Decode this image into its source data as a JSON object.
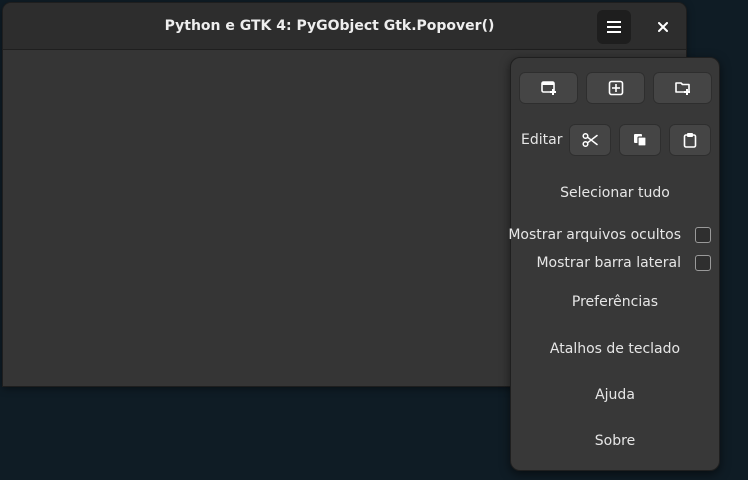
{
  "window": {
    "title": "Python e GTK 4: PyGObject Gtk.Popover()",
    "menu_icon": "hamburger-menu-icon",
    "close_icon": "close-icon"
  },
  "popover": {
    "top_buttons": [
      {
        "icon": "new-window-icon"
      },
      {
        "icon": "new-tab-icon"
      },
      {
        "icon": "new-folder-icon"
      }
    ],
    "edit_label": "Editar",
    "edit_buttons": [
      {
        "icon": "cut-icon"
      },
      {
        "icon": "copy-icon"
      },
      {
        "icon": "paste-icon"
      }
    ],
    "select_all": "Selecionar tudo",
    "show_hidden_files": {
      "label": "Mostrar arquivos ocultos",
      "checked": false
    },
    "show_sidebar": {
      "label": "Mostrar barra lateral",
      "checked": false
    },
    "preferences": "Preferências",
    "keyboard_shortcuts": "Atalhos de teclado",
    "help": "Ajuda",
    "about": "Sobre"
  },
  "colors": {
    "desktop": "#0f1c25",
    "window_bg": "#353535",
    "headerbar": "#2d2d2d",
    "popover_bg": "#383838",
    "button_bg": "#454545"
  }
}
